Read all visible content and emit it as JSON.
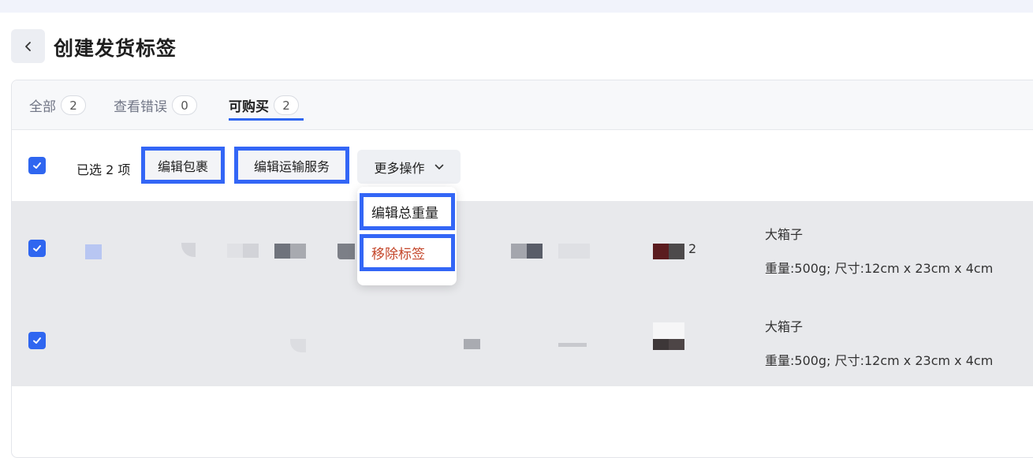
{
  "page": {
    "title": "创建发货标签"
  },
  "tabs": [
    {
      "label": "全部",
      "count": "2"
    },
    {
      "label": "查看错误",
      "count": "0"
    },
    {
      "label": "可购买",
      "count": "2"
    }
  ],
  "toolbar": {
    "selected_text": "已选 2 项",
    "edit_package": "编辑包裹",
    "edit_shipping": "编辑运输服务",
    "more_actions": "更多操作"
  },
  "more_menu": {
    "edit_weight": "编辑总重量",
    "remove_label": "移除标签"
  },
  "rows": [
    {
      "box_name": "大箱子",
      "spec": "重量:500g; 尺寸:12cm x 23cm x 4cm",
      "qty": "2"
    },
    {
      "box_name": "大箱子",
      "spec": "重量:500g; 尺寸:12cm x 23cm x 4cm"
    }
  ],
  "colors": {
    "accent": "#2f66f0",
    "highlight": "#3366f6",
    "danger": "#c4472b"
  }
}
